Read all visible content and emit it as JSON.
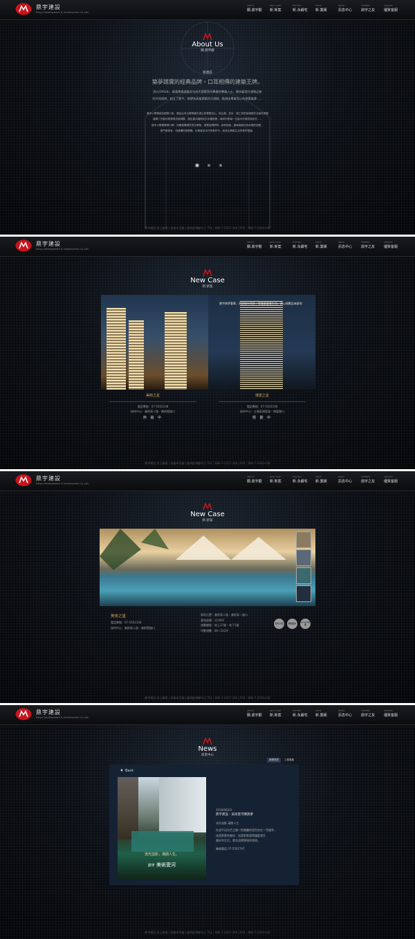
{
  "brand": {
    "name_cn": "鼎宇建設",
    "name_en": "Dinyu Development & Construction Co.,Ltd."
  },
  "nav": [
    {
      "en": "ABOUT",
      "label": "關.鼎宇觀"
    },
    {
      "en": "NEW CASE",
      "label": "新.新案"
    },
    {
      "en": "HISTORY",
      "label": "新.永續宅"
    },
    {
      "en": "MOVE",
      "label": "新.業績"
    },
    {
      "en": "NEWS",
      "label": "訊息中心"
    },
    {
      "en": "FRIENDS",
      "label": "鼎宇之友"
    },
    {
      "en": "SERVICE",
      "label": "優質客服"
    }
  ],
  "footer": "鼎宇建設  詳上聯落 | 高雄市苓雅二路8號(8樓A2) | TEL : 886-7-3317-348 | FAX : 886-7-3300-438",
  "about": {
    "title": "About Us",
    "subtitle": "關.鼎宇觀",
    "person": "蔡達莊",
    "slogan": "築夢踏實的經典品牌・口耳相傳的建築王牌。",
    "paragraphs": [
      "西元1992年，懷著專業建築多位成大建築系所畢業的專業人士，秉持著提升建築品質",
      "的共同理想，創立了鼎宇，期望為高雄建築的天際線，點燃出專業用心的建築美夢……",
      "鼎宇以專業誠信經營十餘，集結台灣大學等國內頂尖的專業用心，從企劃、設計、施工到售後服務的全面性規劃",
      "建構了完善的經營理念與規模，穩定邁向國際化的永續經營，尋求的是每一位客戶的滿意與信任……",
      "鼎宇以實績累積口碑，持續建構優質居住環境，落實品牌精神，創新突破，讓每個家成為幸福的起點。",
      "座門與家家，待建構的誠實願，在雅客並本作的美好中，綻放出精緻生活的美好價值。"
    ]
  },
  "newcase": {
    "title": "New Case",
    "subtitle": "新.新案",
    "overlay": "鼎宇跨界奢華，再造城市傳奇 / 實踐最優雅生活，精心規劃品味豪宅",
    "cases": [
      {
        "name": "美術之星",
        "line1": "電話專線：07-5502338",
        "line2": "接待中心：美術東二路・美術館路口",
        "status": "熱 銷 中"
      },
      {
        "name": "博愛之星",
        "line1": "電話專線：07-5502338",
        "line2": "接待中心：左營區博愛路・博愛路口",
        "status": "規 劃 中"
      }
    ]
  },
  "detail": {
    "title": "New Case",
    "subtitle": "新.新案",
    "name": "美術之星",
    "contact": [
      "電話專線：07-5502338",
      "接待中心：美術東二路・美術館路口"
    ],
    "specs": [
      "基地位置：美術東二路・美術東一路口",
      "基地面積：1100坪",
      "規劃樓層：地上27層・地下5層",
      "坪數規劃：86~232坪"
    ],
    "buttons": [
      "環境介紹",
      "規劃設計",
      "google地圖"
    ]
  },
  "news": {
    "title": "News",
    "subtitle": "訊息中心",
    "tabs": [
      "新聞快訊",
      "工程進度"
    ],
    "back": "Back",
    "date": "2016/06/03",
    "headline": "鼎宇建設 - 美術愛河購買夢",
    "body": [
      "流光溢影 滿閱人生",
      "在說不出光芒之間一悅美麗的澄世存在一世優秀...",
      "這是那麼的美好，這是那麼值得讓愛發生",
      "美好的生活，就在這裡實現與發現。"
    ],
    "tel": "聯絡電話 07-5502797",
    "poster_line1": "流光溢影，滿閱人生。",
    "poster_brand": "鼎宇",
    "poster_name": "美術愛河"
  }
}
